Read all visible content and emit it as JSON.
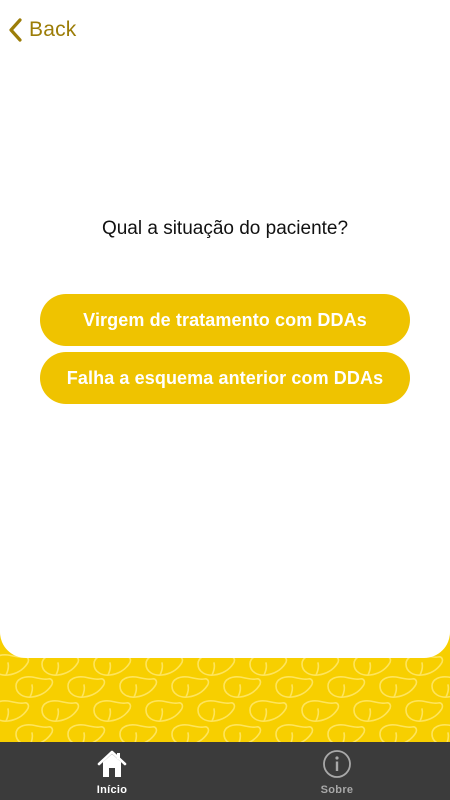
{
  "header": {
    "back_label": "Back",
    "back_icon": "chevron-left-icon"
  },
  "main": {
    "question": "Qual a situação do paciente?",
    "options": [
      {
        "label": "Virgem de tratamento com DDAs"
      },
      {
        "label": "Falha a esquema anterior com DDAs"
      }
    ]
  },
  "tabbar": {
    "tabs": [
      {
        "label": "Início",
        "icon": "home-icon",
        "active": true
      },
      {
        "label": "Sobre",
        "icon": "info-icon",
        "active": false
      }
    ]
  },
  "colors": {
    "brand_yellow": "#f7cf00",
    "button_yellow": "#efc300",
    "back_gold": "#9c7d08",
    "tabbar_bg": "#3b3b3b"
  }
}
